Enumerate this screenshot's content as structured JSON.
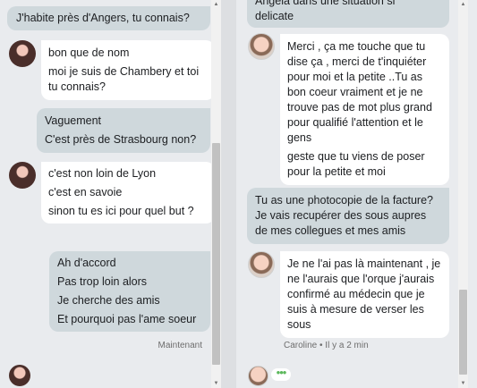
{
  "left": {
    "m1": {
      "lines": [
        "J'habite près d'Angers, tu connais?"
      ]
    },
    "m2": {
      "lines": [
        "bon que de  nom",
        "moi je suis de Chambery et toi tu connais?"
      ]
    },
    "m3": {
      "lines": [
        "Vaguement",
        "C'est près de Strasbourg non?"
      ]
    },
    "m4": {
      "lines": [
        "c'est  non  loin de  Lyon",
        "c'est en savoie",
        "sinon  tu es ici  pour quel but ?"
      ]
    },
    "m5": {
      "lines": [
        "Ah d'accord",
        "Pas trop loin alors",
        "Je cherche des amis",
        "Et pourquoi pas l'ame soeur"
      ]
    },
    "timestamp": "Maintenant"
  },
  "right": {
    "m0": {
      "lines": [
        "Angela dans une situation si",
        "delicate"
      ]
    },
    "m1": {
      "lines": [
        "Merci , ça me touche que tu dise ça , merci de t'inquiéter  pour moi et la petite ..Tu as bon coeur vraiment et je ne trouve pas de mot plus grand pour qualifié l'attention et le gens",
        "geste que tu viens de poser pour  la petite et moi"
      ]
    },
    "m2": {
      "lines": [
        "Tu as une photocopie de la facture? Je vais recupérer des sous aupres de mes collegues et mes amis"
      ]
    },
    "m3": {
      "lines": [
        "Je ne l'ai pas là maintenant , je ne l'aurais que l'orque j'aurais confirmé au médecin que je suis à mesure de verser les sous"
      ]
    },
    "meta": "Caroline • Il y a 2 min"
  }
}
